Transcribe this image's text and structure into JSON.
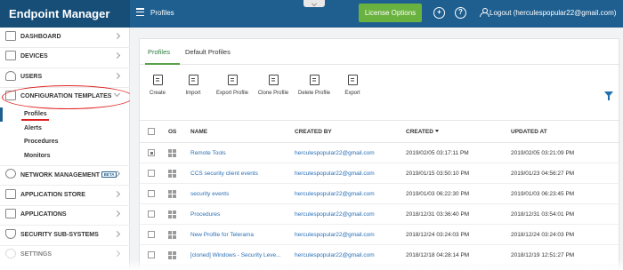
{
  "app": {
    "title": "Endpoint Manager",
    "page_title": "Profiles"
  },
  "topbar": {
    "license_button": "License Options",
    "logout_label": "Logout (herculespopular22@gmail.com)",
    "plus_icon_glyph": "+",
    "help_icon_glyph": "?"
  },
  "sidebar": {
    "items": [
      {
        "label": "DASHBOARD",
        "icon": "dashboard-icon"
      },
      {
        "label": "DEVICES",
        "icon": "devices-icon"
      },
      {
        "label": "USERS",
        "icon": "users-icon"
      },
      {
        "label": "CONFIGURATION TEMPLATES",
        "icon": "config-templates-icon",
        "expanded": true
      },
      {
        "label": "NETWORK MANAGEMENT",
        "icon": "network-icon",
        "badge": "BETA"
      },
      {
        "label": "APPLICATION STORE",
        "icon": "app-store-icon"
      },
      {
        "label": "APPLICATIONS",
        "icon": "applications-icon"
      },
      {
        "label": "SECURITY SUB-SYSTEMS",
        "icon": "shield-icon"
      },
      {
        "label": "SETTINGS",
        "icon": "gear-icon"
      }
    ],
    "sub_items": [
      "Profiles",
      "Alerts",
      "Procedures",
      "Monitors"
    ]
  },
  "tabs": [
    "Profiles",
    "Default Profiles"
  ],
  "toolbar": [
    "Create",
    "Import",
    "Export Profile",
    "Clone Profile",
    "Delete Profile",
    "Export"
  ],
  "table": {
    "columns": [
      "OS",
      "NAME",
      "CREATED BY",
      "CREATED",
      "UPDATED AT"
    ],
    "rows": [
      {
        "name": "Remote Tools",
        "created_by": "herculespopular22@gmail.com",
        "created": "2019/02/05 03:17:11 PM",
        "updated": "2019/02/05 03:21:09 PM",
        "checked": true
      },
      {
        "name": "CCS security client events",
        "created_by": "herculespopular22@gmail.com",
        "created": "2019/01/15 03:50:10 PM",
        "updated": "2019/01/23 04:56:27 PM",
        "checked": false
      },
      {
        "name": "security events",
        "created_by": "herculespopular22@gmail.com",
        "created": "2019/01/03 06:22:30 PM",
        "updated": "2019/01/03 06:23:45 PM",
        "checked": false
      },
      {
        "name": "Procedures",
        "created_by": "herculespopular22@gmail.com",
        "created": "2018/12/31 03:36:40 PM",
        "updated": "2018/12/31 03:54:01 PM",
        "checked": false
      },
      {
        "name": "New Profile for Telerama",
        "created_by": "herculespopular22@gmail.com",
        "created": "2018/12/24 03:24:03 PM",
        "updated": "2018/12/24 03:24:03 PM",
        "checked": false
      },
      {
        "name": "[cloned] Windows - Security Leve...",
        "created_by": "herculespopular22@gmail.com",
        "created": "2018/12/18 04:28:14 PM",
        "updated": "2018/12/19 12:51:27 PM",
        "checked": false
      }
    ]
  },
  "colors": {
    "topbar": "#1f5f8f",
    "license_button": "#6ab23f",
    "link": "#2a6fb5",
    "annotation": "#e02020"
  }
}
